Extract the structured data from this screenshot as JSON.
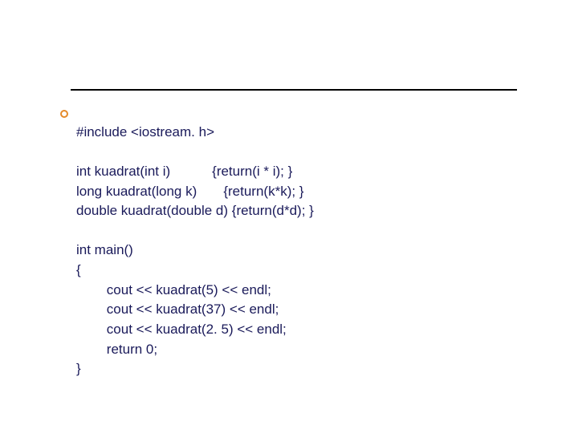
{
  "code": {
    "line1": "#include <iostream. h>",
    "blank1": "",
    "fn1_sig": "int kuadrat(int i)",
    "fn1_body": "{return(i * i); }",
    "fn2_sig": "long kuadrat(long k)",
    "fn2_body": "{return(k*k); }",
    "fn3_sig": "double kuadrat(double d)",
    "fn3_body": "{return(d*d); }",
    "blank2": "",
    "main_decl": "int main()",
    "brace_open": "{",
    "stmt1": "cout << kuadrat(5) << endl;",
    "stmt2": "cout << kuadrat(37) << endl;",
    "stmt3": "cout << kuadrat(2. 5) << endl;",
    "stmt4": "return 0;",
    "brace_close": "}"
  }
}
